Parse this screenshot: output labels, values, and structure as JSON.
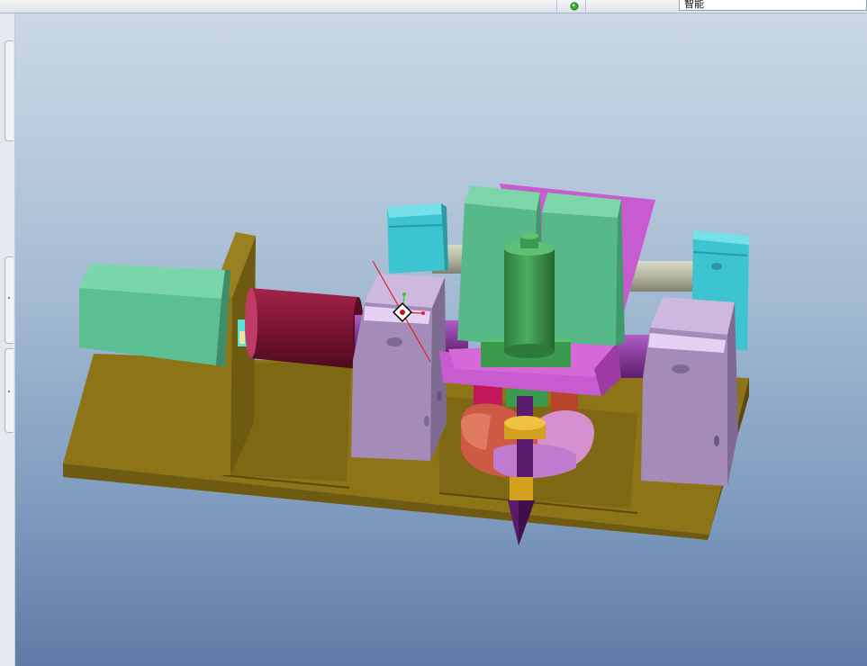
{
  "toolbar": {
    "filter_value": "智能"
  },
  "viewport": {
    "background_top": "#cad8e6",
    "background_bottom": "#5d7ba6"
  },
  "model_colors": {
    "base_plate": "#8c7417",
    "motor_body": "#5cbf94",
    "motor_can": "#8c1a3a",
    "support_block": "#a48bb8",
    "end_bracket": "#3cc4d0",
    "guide_rod": "#b9baa8",
    "carriage_plate": "#c95bd0",
    "carriage_block": "#57b888",
    "center_column": "#3b9a4e",
    "cam_red": "#cc5a44",
    "cam_pink": "#d690d0",
    "needle": "#5a1a6e",
    "collar_yellow": "#d4a020"
  },
  "icons": {
    "status": "green-light-icon",
    "coordinate_system": "csys-icon"
  }
}
